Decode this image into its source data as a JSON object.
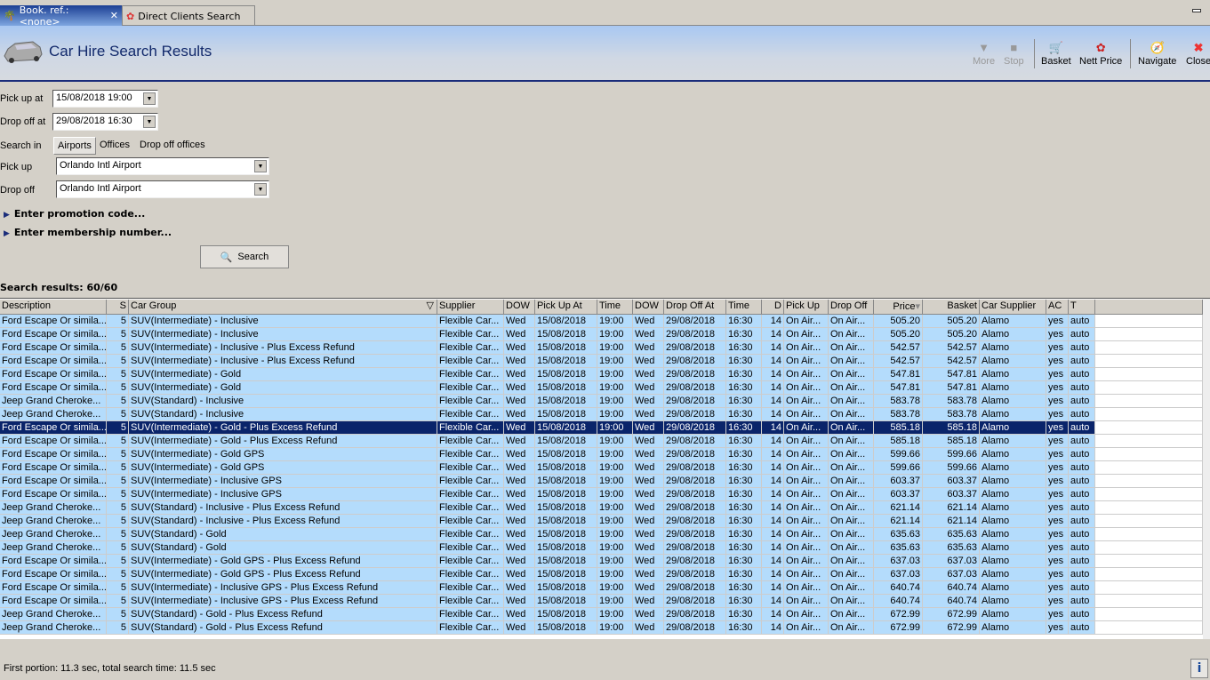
{
  "tabs": [
    {
      "label": "Book. ref.: <none>",
      "icon": "palm-tree-icon"
    },
    {
      "label": "Direct Clients Search",
      "icon": "clients-icon"
    }
  ],
  "header": {
    "title": "Car Hire Search Results"
  },
  "toolbar": {
    "more": "More",
    "stop": "Stop",
    "basket": "Basket",
    "nett_price": "Nett Price",
    "navigate": "Navigate",
    "close": "Close"
  },
  "form": {
    "pickup_at_label": "Pick up at",
    "pickup_at": "15/08/2018 19:00",
    "dropoff_at_label": "Drop off at",
    "dropoff_at": "29/08/2018 16:30",
    "search_in_label": "Search in",
    "search_in_options": [
      "Airports",
      "Offices",
      "Drop off offices"
    ],
    "pickup_label": "Pick up",
    "pickup": "Orlando Intl Airport",
    "dropoff_label": "Drop off",
    "dropoff": "Orlando Intl Airport",
    "promo": "Enter promotion code...",
    "membership": "Enter membership number...",
    "search": "Search"
  },
  "results_label": "Search results: 60/60",
  "columns": [
    "Description",
    "S",
    "Car Group",
    "Supplier",
    "DOW",
    "Pick Up At",
    "Time",
    "DOW",
    "Drop Off At",
    "Time",
    "D",
    "Pick Up",
    "Drop Off",
    "Price",
    "Basket",
    "Car Supplier",
    "AC",
    "T"
  ],
  "selected_row": 8,
  "rows": [
    [
      "Ford Escape Or simila...",
      "5",
      "SUV(Intermediate) - Inclusive",
      "505.20"
    ],
    [
      "Ford Escape Or simila...",
      "5",
      "SUV(Intermediate) - Inclusive",
      "505.20"
    ],
    [
      "Ford Escape Or simila...",
      "5",
      "SUV(Intermediate) - Inclusive - Plus Excess Refund",
      "542.57"
    ],
    [
      "Ford Escape Or simila...",
      "5",
      "SUV(Intermediate) - Inclusive - Plus Excess Refund",
      "542.57"
    ],
    [
      "Ford Escape Or simila...",
      "5",
      "SUV(Intermediate) - Gold",
      "547.81"
    ],
    [
      "Ford Escape Or simila...",
      "5",
      "SUV(Intermediate) - Gold",
      "547.81"
    ],
    [
      "Jeep Grand Cheroke...",
      "5",
      "SUV(Standard) - Inclusive",
      "583.78"
    ],
    [
      "Jeep Grand Cheroke...",
      "5",
      "SUV(Standard) - Inclusive",
      "583.78"
    ],
    [
      "Ford Escape Or simila...",
      "5",
      "SUV(Intermediate) - Gold - Plus Excess Refund",
      "585.18"
    ],
    [
      "Ford Escape Or simila...",
      "5",
      "SUV(Intermediate) - Gold - Plus Excess Refund",
      "585.18"
    ],
    [
      "Ford Escape Or simila...",
      "5",
      "SUV(Intermediate) - Gold GPS",
      "599.66"
    ],
    [
      "Ford Escape Or simila...",
      "5",
      "SUV(Intermediate) - Gold GPS",
      "599.66"
    ],
    [
      "Ford Escape Or simila...",
      "5",
      "SUV(Intermediate) - Inclusive GPS",
      "603.37"
    ],
    [
      "Ford Escape Or simila...",
      "5",
      "SUV(Intermediate) - Inclusive GPS",
      "603.37"
    ],
    [
      "Jeep Grand Cheroke...",
      "5",
      "SUV(Standard) - Inclusive - Plus Excess Refund",
      "621.14"
    ],
    [
      "Jeep Grand Cheroke...",
      "5",
      "SUV(Standard) - Inclusive - Plus Excess Refund",
      "621.14"
    ],
    [
      "Jeep Grand Cheroke...",
      "5",
      "SUV(Standard) - Gold",
      "635.63"
    ],
    [
      "Jeep Grand Cheroke...",
      "5",
      "SUV(Standard) - Gold",
      "635.63"
    ],
    [
      "Ford Escape Or simila...",
      "5",
      "SUV(Intermediate) - Gold GPS - Plus Excess Refund",
      "637.03"
    ],
    [
      "Ford Escape Or simila...",
      "5",
      "SUV(Intermediate) - Gold GPS - Plus Excess Refund",
      "637.03"
    ],
    [
      "Ford Escape Or simila...",
      "5",
      "SUV(Intermediate) - Inclusive GPS - Plus Excess Refund",
      "640.74"
    ],
    [
      "Ford Escape Or simila...",
      "5",
      "SUV(Intermediate) - Inclusive GPS - Plus Excess Refund",
      "640.74"
    ],
    [
      "Jeep Grand Cheroke...",
      "5",
      "SUV(Standard) - Gold - Plus Excess Refund",
      "672.99"
    ],
    [
      "Jeep Grand Cheroke...",
      "5",
      "SUV(Standard) - Gold - Plus Excess Refund",
      "672.99"
    ]
  ],
  "row_common": {
    "supplier": "Flexible Car...",
    "dow1": "Wed",
    "pickup_at": "15/08/2018",
    "time1": "19:00",
    "dow2": "Wed",
    "dropoff_at": "29/08/2018",
    "time2": "16:30",
    "days": "14",
    "pickup": "On Air...",
    "dropoff": "On Air...",
    "car_supplier": "Alamo",
    "ac": "yes",
    "t": "auto"
  },
  "status": "First portion: 11.3 sec, total search time: 11.5 sec"
}
